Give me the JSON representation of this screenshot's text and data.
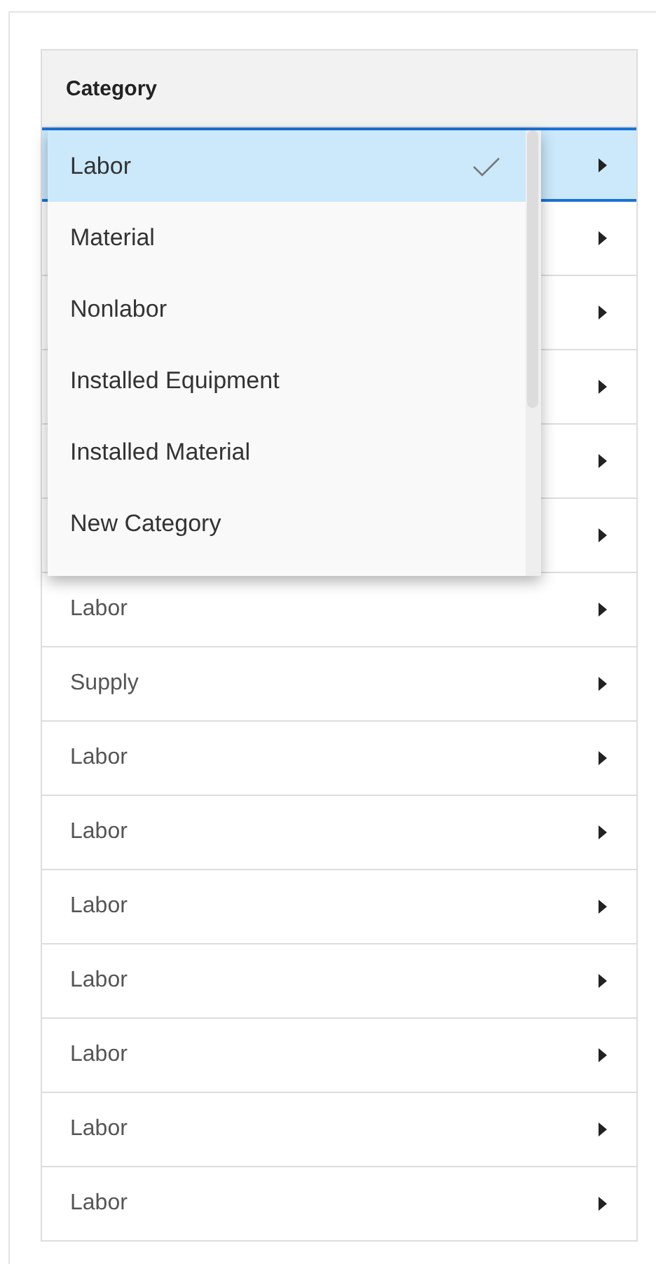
{
  "table": {
    "columns": [
      "Category"
    ],
    "rows": [
      {
        "editing": true
      },
      {
        "editing": false
      },
      {
        "editing": false
      },
      {
        "editing": false
      },
      {
        "editing": false
      },
      {
        "editing": false
      },
      {
        "value": "Labor",
        "editing": false
      },
      {
        "value": "Supply",
        "editing": false
      },
      {
        "value": "Labor",
        "editing": false
      },
      {
        "value": "Labor",
        "editing": false
      },
      {
        "value": "Labor",
        "editing": false
      },
      {
        "value": "Labor",
        "editing": false
      },
      {
        "value": "Labor",
        "editing": false
      },
      {
        "value": "Labor",
        "editing": false
      },
      {
        "value": "Labor",
        "editing": false
      }
    ]
  },
  "dropdown": {
    "options": [
      {
        "label": "Labor",
        "selected": true
      },
      {
        "label": "Material",
        "selected": false
      },
      {
        "label": "Nonlabor",
        "selected": false
      },
      {
        "label": "Installed Equipment",
        "selected": false
      },
      {
        "label": "Installed Material",
        "selected": false
      },
      {
        "label": "New Category",
        "selected": false
      }
    ]
  }
}
